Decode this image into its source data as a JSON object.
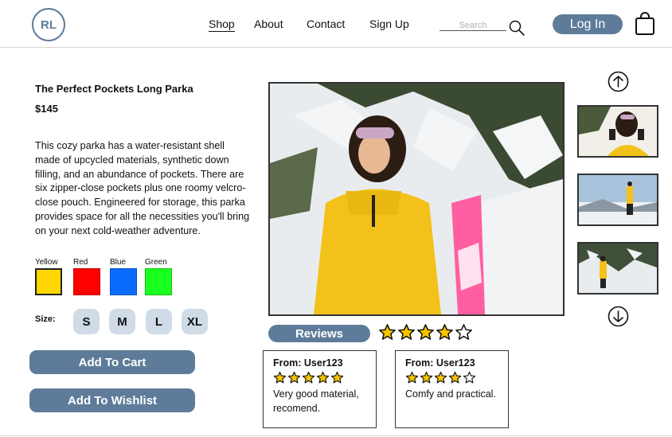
{
  "logo": "RL",
  "nav": [
    "Shop",
    "About",
    "Contact",
    "Sign Up"
  ],
  "search": {
    "placeholder": "Search"
  },
  "login": "Log In",
  "product": {
    "title": "The Perfect Pockets Long Parka",
    "price": "$145",
    "description": "This cozy parka has a water-resistant shell made of upcycled materials, synthetic down filling, and an abundance of pockets. There are six zipper-close pockets plus one roomy velcro-close pouch. Engineered for storage, this parka provides space for all the necessities you'll bring on your next cold-weather adventure."
  },
  "colors": [
    {
      "label": "Yellow",
      "hex": "#ffd700",
      "selected": true
    },
    {
      "label": "Red",
      "hex": "#ff0000",
      "selected": false
    },
    {
      "label": "Blue",
      "hex": "#0a6cff",
      "selected": false
    },
    {
      "label": "Green",
      "hex": "#19ff1e",
      "selected": false
    }
  ],
  "size": {
    "label": "Size:",
    "options": [
      "S",
      "M",
      "L",
      "XL"
    ]
  },
  "actions": {
    "add_to_cart": "Add To Cart",
    "add_to_wishlist": "Add To Wishlist"
  },
  "reviews": {
    "label": "Reviews",
    "average_rating": 4,
    "max_rating": 5,
    "items": [
      {
        "from": "From: User123",
        "rating": 5,
        "text": "Very good material, recomend."
      },
      {
        "from": "From: User123",
        "rating": 4,
        "text": "Comfy and practical."
      }
    ]
  },
  "colors_theme": {
    "accent": "#5e7c99",
    "size_chip": "#cfdbe6",
    "star_fill": "#f5c400"
  },
  "icons": [
    "search-icon",
    "shopping-bag-icon",
    "arrow-up-circle-icon",
    "arrow-down-circle-icon",
    "star-icon"
  ]
}
